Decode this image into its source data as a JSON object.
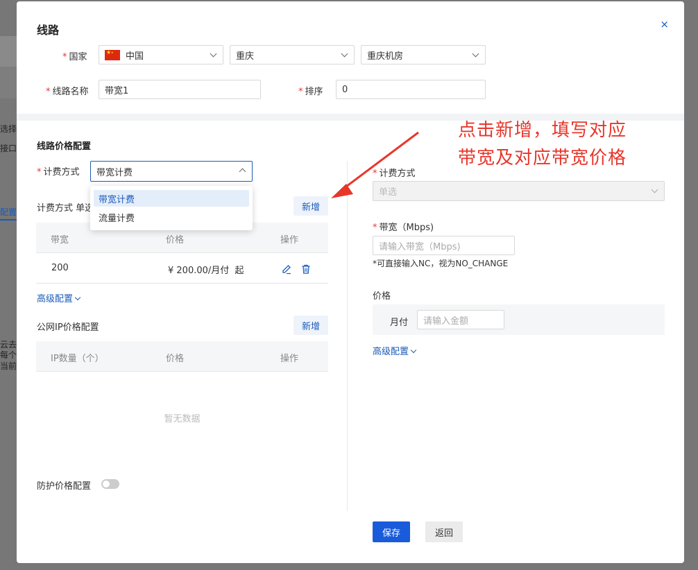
{
  "background": {
    "left_texts": [
      "选择",
      "接口",
      "配置",
      "云去",
      "每个",
      "当前"
    ]
  },
  "modal": {
    "title": "线路",
    "close_icon": "×",
    "country_label": "国家",
    "country_value": "中国",
    "province_value": "重庆",
    "datacenter_value": "重庆机房",
    "line_name_label": "线路名称",
    "line_name_value": "带宽1",
    "sort_label": "排序",
    "sort_value": "0"
  },
  "left": {
    "section_title": "线路价格配置",
    "billing_label": "计费方式",
    "billing_value": "带宽计费",
    "billing_options": [
      "带宽计费",
      "流量计费"
    ],
    "billing_sub_label": "计费方式 单选",
    "add_label": "新增",
    "bw_table": {
      "headers": [
        "带宽",
        "价格",
        "操作"
      ],
      "rows": [
        {
          "bandwidth": "200",
          "price": "¥ 200.00/月付  起"
        }
      ]
    },
    "advanced_label": "高级配置",
    "ip_section_title": "公网IP价格配置",
    "ip_add_label": "新增",
    "ip_table": {
      "headers": [
        "IP数量（个）",
        "价格",
        "操作"
      ],
      "empty_text": "暂无数据"
    },
    "defense_label": "防护价格配置"
  },
  "right": {
    "billing_label": "计费方式",
    "billing_placeholder": "单选",
    "bandwidth_label": "带宽（Mbps)",
    "bandwidth_placeholder": "请输入带宽（Mbps)",
    "bandwidth_hint": "*可直接输入NC，视为NO_CHANGE",
    "price_label": "价格",
    "monthly_label": "月付",
    "amount_placeholder": "请输入金额",
    "advanced_label": "高级配置"
  },
  "footer": {
    "save_label": "保存",
    "back_label": "返回"
  },
  "annotation": {
    "line1": "点击新增，填写对应",
    "line2": "带宽及对应带宽价格"
  },
  "colors": {
    "primary": "#1a5bdc",
    "link": "#1a5bb8",
    "required": "#e33333",
    "annotation": "#e8362b"
  }
}
